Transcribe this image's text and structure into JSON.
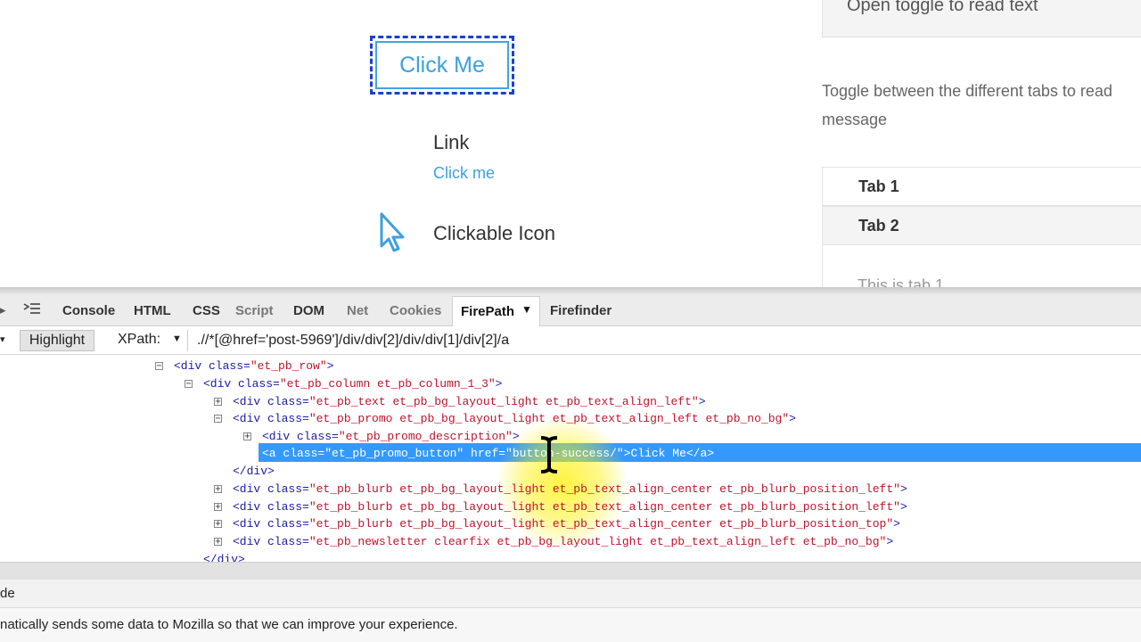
{
  "page": {
    "button_label": "Click Me",
    "link_heading": "Link",
    "link_text": "Click me",
    "icon_heading": "Clickable Icon",
    "toggle_title": "Open toggle to read text",
    "toggle_description": "Toggle between the different tabs to read message",
    "tabs": [
      {
        "label": "Tab 1"
      },
      {
        "label": "Tab 2"
      }
    ],
    "tab_content_partial": "This is tab 1"
  },
  "firebug": {
    "tabs": [
      {
        "label": "Console",
        "active": false
      },
      {
        "label": "HTML",
        "active": false
      },
      {
        "label": "CSS",
        "active": false
      },
      {
        "label": "Script",
        "active": false
      },
      {
        "label": "DOM",
        "active": false
      },
      {
        "label": "Net",
        "active": false
      },
      {
        "label": "Cookies",
        "active": false
      },
      {
        "label": "FirePath",
        "active": true
      },
      {
        "label": "Firefinder",
        "active": false
      }
    ],
    "toolbar": {
      "highlight_label": "Highlight",
      "xpath_label": "XPath:",
      "xpath_value": ".//*[@href='post-5969']/div/div[2]/div/div[1]/div[2]/a"
    },
    "tree": [
      {
        "toggle": "minus",
        "text": "<div class=\"et_pb_row\">"
      },
      {
        "toggle": "minus",
        "text": "<div class=\"et_pb_column et_pb_column_1_3\">"
      },
      {
        "toggle": "plus",
        "text": "<div class=\"et_pb_text et_pb_bg_layout_light et_pb_text_align_left\">"
      },
      {
        "toggle": "minus",
        "text": "<div class=\"et_pb_promo et_pb_bg_layout_light et_pb_text_align_left et_pb_no_bg\">"
      },
      {
        "toggle": "plus",
        "text": "<div class=\"et_pb_promo_description\">"
      },
      {
        "toggle": "none",
        "text": "<a class=\"et_pb_promo_button\" href=\"button-success/\">Click Me</a>",
        "selected": true
      },
      {
        "toggle": "none",
        "text": "</div>"
      },
      {
        "toggle": "plus",
        "text": "<div class=\"et_pb_blurb et_pb_bg_layout_light et_pb_text_align_center et_pb_blurb_position_left\">"
      },
      {
        "toggle": "plus",
        "text": "<div class=\"et_pb_blurb et_pb_bg_layout_light et_pb_text_align_center et_pb_blurb_position_left\">"
      },
      {
        "toggle": "plus",
        "text": "<div class=\"et_pb_blurb et_pb_bg_layout_light et_pb_text_align_center et_pb_blurb_position_top\">"
      },
      {
        "toggle": "plus",
        "text": "<div class=\"et_pb_newsletter clearfix et_pb_bg_layout_light et_pb_text_align_left et_pb_no_bg\">"
      },
      {
        "toggle": "none",
        "text": "</div>"
      }
    ]
  },
  "notification": {
    "line1": "de",
    "line2": "natically sends some data to Mozilla so that we can improve your experience."
  },
  "colors": {
    "link_blue": "#3ea0dd",
    "selection_blue": "#3399ff",
    "tag_blue": "#1a1aa6",
    "attr_red": "#c0142c"
  }
}
